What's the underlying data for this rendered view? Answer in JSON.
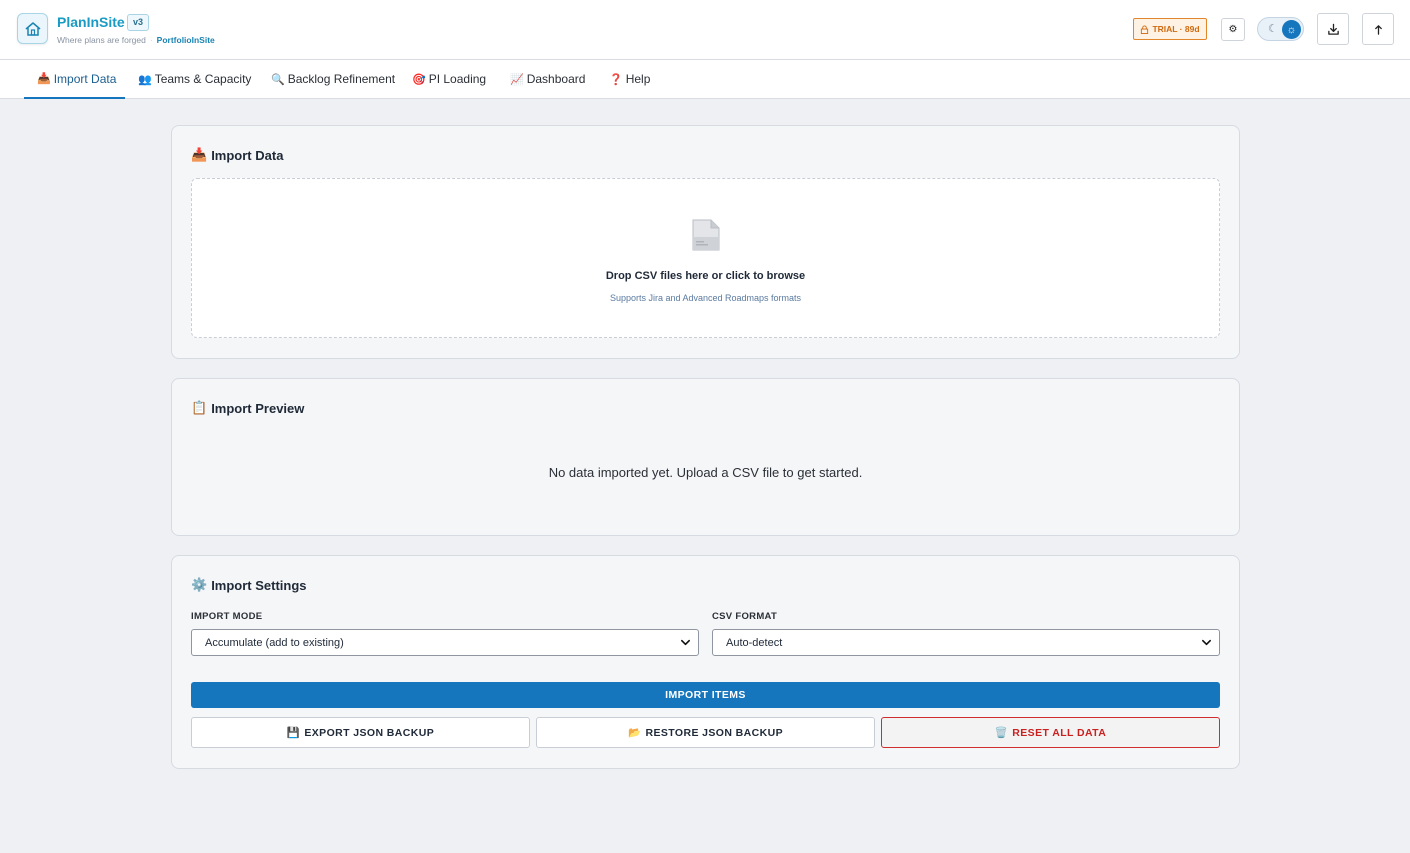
{
  "header": {
    "app_title": "PlanInSite",
    "version": "v3",
    "tagline": "Where plans are forged",
    "brand": "PortfolioInSite",
    "trial_label": "TRIAL · 89d",
    "icons": {
      "logo": "house-icon",
      "lock": "lock-icon",
      "settings": "gear-icon",
      "theme_dark": "moon-icon",
      "theme_light": "sun-icon",
      "download": "download-icon",
      "upload": "upload-arrow-icon"
    }
  },
  "tabs": [
    {
      "label": "Import Data",
      "icon": "📥",
      "active": true
    },
    {
      "label": "Teams & Capacity",
      "icon": "👥",
      "active": false
    },
    {
      "label": "Backlog Refinement",
      "icon": "🔍",
      "active": false
    },
    {
      "label": "PI Loading",
      "icon": "🎯",
      "active": false
    },
    {
      "label": "Dashboard",
      "icon": "📈",
      "active": false
    },
    {
      "label": "Help",
      "icon": "❓",
      "active": false
    }
  ],
  "import_card": {
    "title": "Import Data",
    "icon": "📥",
    "drop_title": "Drop CSV files here or click to browse",
    "drop_subtitle": "Supports Jira and Advanced Roadmaps formats"
  },
  "preview_card": {
    "title": "Import Preview",
    "icon": "📋",
    "empty_message": "No data imported yet. Upload a CSV file to get started."
  },
  "settings_card": {
    "title": "Import Settings",
    "icon": "⚙️",
    "import_mode_label": "IMPORT MODE",
    "import_mode_value": "Accumulate (add to existing)",
    "csv_format_label": "CSV FORMAT",
    "csv_format_value": "Auto-detect",
    "import_button": "IMPORT ITEMS",
    "export_button": "EXPORT JSON BACKUP",
    "export_icon": "💾",
    "restore_button": "RESTORE JSON BACKUP",
    "restore_icon": "📂",
    "reset_button": "RESET ALL DATA",
    "reset_icon": "🗑️"
  },
  "colors": {
    "accent": "#1575bd",
    "brand": "#1a9bc4",
    "trial": "#d06a10",
    "danger": "#c92020"
  }
}
